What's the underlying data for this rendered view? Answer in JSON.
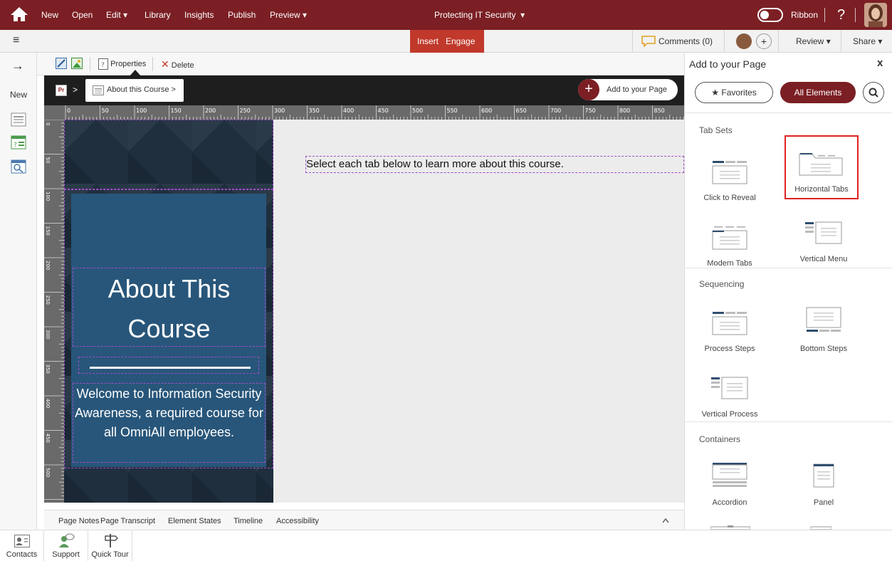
{
  "topbar": {
    "menu": [
      "New",
      "Open",
      "Edit",
      "Library",
      "Insights",
      "Publish",
      "Preview"
    ],
    "edit_caret": "▾",
    "preview_caret": "▾",
    "title": "Protecting IT Security",
    "title_caret": "▾",
    "ribbon_label": "Ribbon",
    "help": "?",
    "brand_color": "#7b1f24"
  },
  "bar2": {
    "menu_icon": "≡",
    "insert": "Insert",
    "engage": "Engage",
    "comments": "Comments (0)",
    "add": "+",
    "review": "Review",
    "share": "Share",
    "caret": "▾"
  },
  "leftbar": {
    "arrow": "→",
    "new_label": "New"
  },
  "toolbar": {
    "properties": "Properties",
    "delete": "Delete",
    "delete_icon": "✕"
  },
  "crumbs": {
    "pr": "Pr",
    "sep1": ">",
    "page": "About this Course >",
    "add_button": "Add to your Page",
    "plus": "+"
  },
  "ruler": {
    "ticks": [
      "0",
      "50",
      "100",
      "150",
      "200",
      "250",
      "300",
      "350",
      "400",
      "450",
      "500",
      "550",
      "600",
      "650",
      "700",
      "750",
      "800",
      "850"
    ]
  },
  "slide": {
    "heading": "About This Course",
    "body": "Welcome to Information Security Awareness, a required course for all OmniAll employees.",
    "side_text": "Select each tab below to learn more about this course."
  },
  "bottomtabs": [
    "Page Notes",
    "Page Transcript",
    "Element States",
    "Timeline",
    "Accessibility"
  ],
  "footer": [
    "Contacts",
    "Support",
    "Quick Tour"
  ],
  "rpanel": {
    "title": "Add to your Page",
    "close": "x",
    "favorites": "Favorites",
    "all_elements": "All Elements",
    "sections": [
      {
        "title": "Tab Sets",
        "items": [
          "Click to Reveal",
          "Horizontal Tabs",
          "Modern Tabs",
          "Vertical Menu"
        ]
      },
      {
        "title": "Sequencing",
        "items": [
          "Process Steps",
          "Bottom Steps",
          "Vertical Process"
        ]
      },
      {
        "title": "Containers",
        "items": [
          "Accordion",
          "Panel"
        ]
      }
    ]
  }
}
